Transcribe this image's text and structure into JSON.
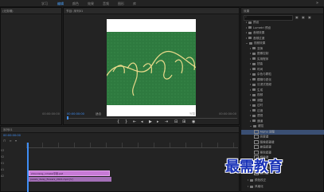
{
  "menu": {
    "items": [
      "学习",
      "编辑",
      "颜色",
      "效果",
      "音频",
      "图形",
      "库"
    ],
    "active_index": 1
  },
  "source_panel": {
    "title": "(无剪辑)",
    "tabs": [
      "源",
      "音频剪辑混合器",
      "元"
    ],
    "timecode_right": "00:00:00:00"
  },
  "program_panel": {
    "title": "节目: 序列01",
    "timecode": "00:00:00:00",
    "fit_label": "适合",
    "quality": "完整",
    "duration": "00:00:00:00"
  },
  "effects_panel": {
    "title": "效果",
    "items": [
      {
        "label": "预设",
        "level": 0,
        "type": "folder"
      },
      {
        "label": "Lumetri 预设",
        "level": 0,
        "type": "folder"
      },
      {
        "label": "音频效果",
        "level": 0,
        "type": "folder"
      },
      {
        "label": "音频过渡",
        "level": 0,
        "type": "folder"
      },
      {
        "label": "视频效果",
        "level": 0,
        "type": "folder",
        "open": true
      },
      {
        "label": "变换",
        "level": 1,
        "type": "folder"
      },
      {
        "label": "图像控制",
        "level": 1,
        "type": "folder"
      },
      {
        "label": "实用程序",
        "level": 1,
        "type": "folder"
      },
      {
        "label": "扭曲",
        "level": 1,
        "type": "folder"
      },
      {
        "label": "时间",
        "level": 1,
        "type": "folder"
      },
      {
        "label": "杂色与颗粒",
        "level": 1,
        "type": "folder"
      },
      {
        "label": "模糊与锐化",
        "level": 1,
        "type": "folder"
      },
      {
        "label": "沉浸式视频",
        "level": 1,
        "type": "folder"
      },
      {
        "label": "生成",
        "level": 1,
        "type": "folder"
      },
      {
        "label": "视频",
        "level": 1,
        "type": "folder"
      },
      {
        "label": "调整",
        "level": 1,
        "type": "folder"
      },
      {
        "label": "过时",
        "level": 1,
        "type": "folder"
      },
      {
        "label": "过渡",
        "level": 1,
        "type": "folder"
      },
      {
        "label": "透视",
        "level": 1,
        "type": "folder"
      },
      {
        "label": "通道",
        "level": 1,
        "type": "folder"
      },
      {
        "label": "键控",
        "level": 1,
        "type": "folder",
        "open": true
      },
      {
        "label": "Alpha 调整",
        "level": 2,
        "type": "fx",
        "selected": true
      },
      {
        "label": "亮度键",
        "level": 2,
        "type": "fx"
      },
      {
        "label": "图像遮罩键",
        "level": 2,
        "type": "fx"
      },
      {
        "label": "差值遮罩",
        "level": 2,
        "type": "fx"
      },
      {
        "label": "移除遮罩",
        "level": 2,
        "type": "fx"
      },
      {
        "label": "超级键",
        "level": 2,
        "type": "fx"
      },
      {
        "label": "轨道遮罩键",
        "level": 2,
        "type": "fx"
      },
      {
        "label": "非红色键",
        "level": 2,
        "type": "fx"
      },
      {
        "label": "颜色键",
        "level": 2,
        "type": "fx"
      }
    ],
    "bottom_items": [
      "颜色校正",
      "风格化"
    ]
  },
  "timeline": {
    "title": "序列01",
    "timecode": "00:00:00:00",
    "tracks": [
      "V3",
      "V2",
      "V1",
      "A1",
      "A2"
    ],
    "clips": [
      {
        "label": "shouxiang_nimelai字幕.psd",
        "track": "V2"
      },
      {
        "label": "pexels_daisy_flowers_2021.mp4 [V]",
        "track": "V1"
      }
    ]
  },
  "watermark": "最需教育"
}
